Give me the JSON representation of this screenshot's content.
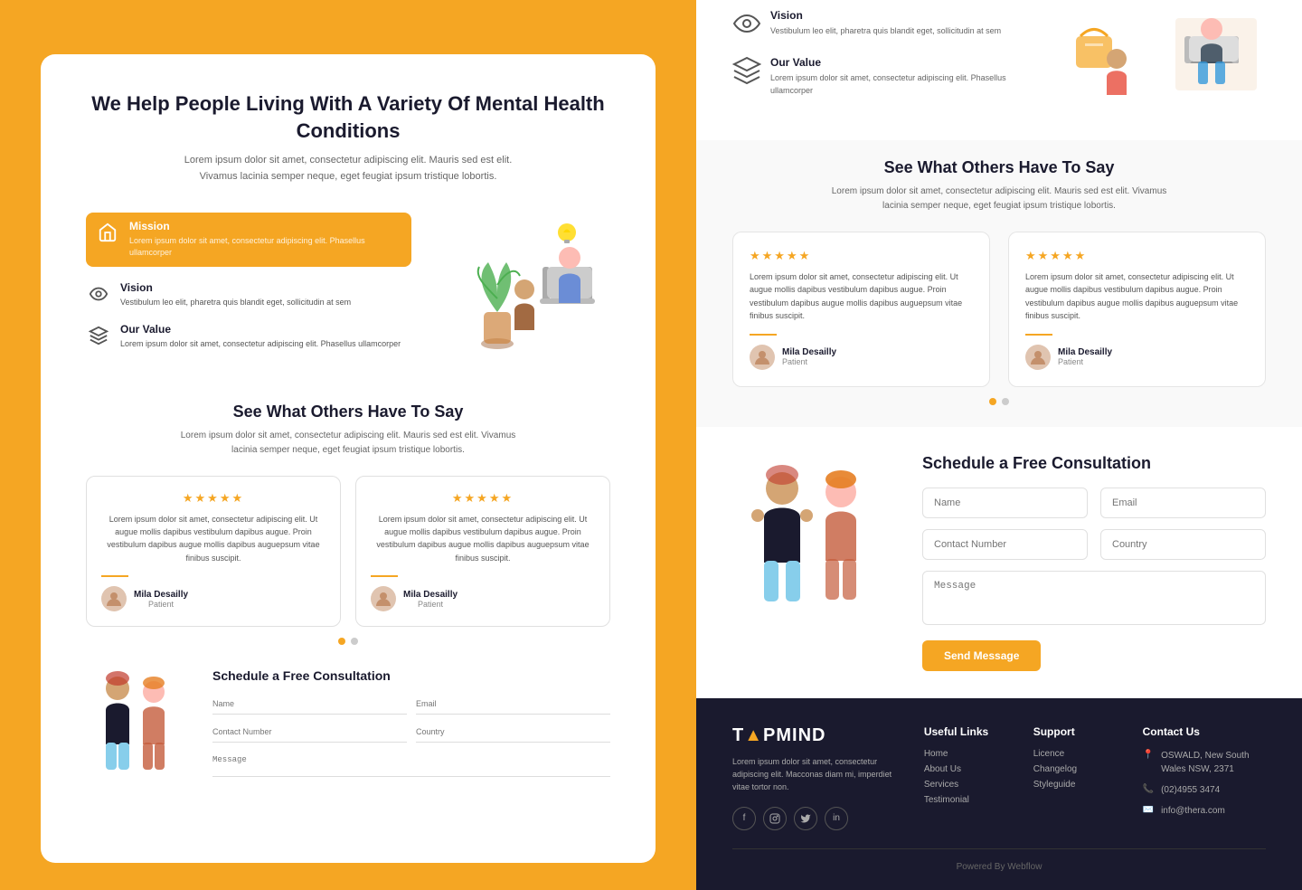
{
  "left": {
    "hero": {
      "title": "We Help People Living With A\nVariety Of Mental Health Conditions",
      "subtitle": "Lorem ipsum dolor sit amet, consectetur adipiscing elit. Mauris sed est elit. Vivamus lacinia semper neque, eget feugiat ipsum tristique lobortis."
    },
    "features": [
      {
        "id": "mission",
        "label": "Mission",
        "desc": "Lorem ipsum dolor sit amet, consectetur adipiscing elit. Phasellus ullamcorper",
        "active": true
      },
      {
        "id": "vision",
        "label": "Vision",
        "desc": "Vestibulum leo elit, pharetra quis blandit eget, sollicitudin at sem",
        "active": false
      },
      {
        "id": "value",
        "label": "Our Value",
        "desc": "Lorem ipsum dolor sit amet, consectetur adipiscing elit. Phasellus ullamcorper",
        "active": false
      }
    ],
    "testimonials": {
      "title": "See What Others Have To Say",
      "subtitle": "Lorem ipsum dolor sit amet, consectetur adipiscing elit. Mauris sed est elit. Vivamus lacinia semper neque, eget feugiat ipsum tristique lobortis.",
      "cards": [
        {
          "stars": "★★★★★",
          "text": "Lorem ipsum dolor sit amet, consectetur adipiscing elit. Ut augue mollis dapibus vestibulum dapibus augue. Proin vestibulum dapibus augue mollis dapibus auguepsum vitae finibus suscipit.",
          "author": "Mila Desailly",
          "role": "Patient"
        },
        {
          "stars": "★★★★★",
          "text": "Lorem ipsum dolor sit amet, consectetur adipiscing elit. Ut augue mollis dapibus vestibulum dapibus augue. Proin vestibulum dapibus augue mollis dapibus auguepsum vitae finibus suscipit.",
          "author": "Mila Desailly",
          "role": "Patient"
        }
      ],
      "dots": [
        true,
        false
      ]
    },
    "schedule": {
      "title": "Schedule a Free Consultation",
      "fields": {
        "name": "Name",
        "email": "Email",
        "contact": "Contact Number",
        "country": "Country",
        "message": "Message"
      }
    }
  },
  "right": {
    "top_features": [
      {
        "label": "Vision",
        "desc": "Vestibulum leo elit, pharetra quis blandit eget, sollicitudin at sem"
      },
      {
        "label": "Our Value",
        "desc": "Lorem ipsum dolor sit amet, consectetur adipiscing elit. Phasellus ullamcorper"
      }
    ],
    "testimonials": {
      "title": "See What Others Have To Say",
      "subtitle": "Lorem ipsum dolor sit amet, consectetur adipiscing elit. Mauris sed est elit. Vivamus lacinia semper neque, eget feugiat ipsum tristique lobortis.",
      "cards": [
        {
          "stars": "★★★★★",
          "text": "Lorem ipsum dolor sit amet, consectetur adipiscing elit. Ut augue mollis dapibus vestibulum dapibus augue. Proin vestibulum dapibus augue mollis dapibus auguepsum vitae finibus suscipit.",
          "author": "Mila Desailly",
          "role": "Patient"
        },
        {
          "stars": "★★★★★",
          "text": "Lorem ipsum dolor sit amet, consectetur adipiscing elit. Ut augue mollis dapibus vestibulum dapibus augue. Proin vestibulum dapibus augue mollis dapibus auguepsum vitae finibus suscipit.",
          "author": "Mila Desailly",
          "role": "Patient"
        }
      ],
      "dots": [
        true,
        false
      ]
    },
    "schedule": {
      "title": "Schedule a Free Consultation",
      "fields": {
        "name": "Name",
        "email": "Email",
        "contact": "Contact Number",
        "country": "Country",
        "message": "Message"
      },
      "button": "Send Message"
    },
    "footer": {
      "brand": "T▲PMIND",
      "brand_desc": "Lorem ipsum dolor sit amet, consectetur adipiscing elit. Macconas diam mi, imperdiet vitae tortor non.",
      "social": [
        "f",
        "in",
        "tw",
        "li"
      ],
      "useful_links": {
        "title": "Useful Links",
        "items": [
          "Home",
          "About Us",
          "Services",
          "Testimonial"
        ]
      },
      "support": {
        "title": "Support",
        "items": [
          "Licence",
          "Changelog",
          "Styleguide"
        ]
      },
      "contact": {
        "title": "Contact Us",
        "address": "OSWALD, New South Wales NSW, 2371",
        "phone": "(02)4955 3474",
        "email": "info@thera.com"
      },
      "powered": "Powered By Webflow"
    }
  },
  "colors": {
    "accent": "#F5A623",
    "dark": "#1a1a2e",
    "footer_bg": "#1a1a2e"
  }
}
